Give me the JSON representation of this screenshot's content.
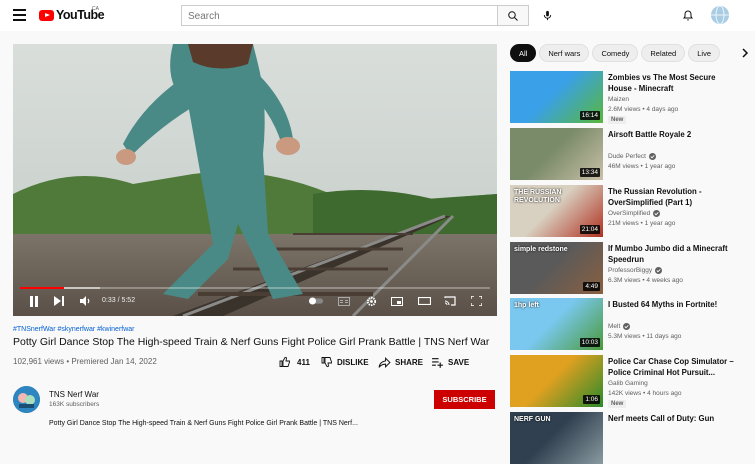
{
  "header": {
    "logo_text": "YouTube",
    "country_code": "CA",
    "search_placeholder": "Search"
  },
  "player": {
    "time_display": "0:33 / 5:52",
    "played_fraction": 0.094,
    "buffered_fraction": 0.17
  },
  "video": {
    "hashtags": "#TNSnerfWar #skynerfwar #kwinerfwar",
    "title": "Potty Girl Dance Stop The High-speed Train & Nerf Guns Fight Police Girl Prank Battle | TNS Nerf War",
    "meta": "102,961 views • Premiered Jan 14, 2022",
    "likes": "411",
    "dislike_label": "DISLIKE",
    "share_label": "SHARE",
    "save_label": "SAVE",
    "description_preview": "Potty Girl Dance Stop The High-speed Train & Nerf Guns Fight Police Girl Prank Battle | TNS Nerf..."
  },
  "channel": {
    "name": "TNS Nerf War",
    "subscribers": "163K subscribers",
    "subscribe_label": "SUBSCRIBE"
  },
  "chips": [
    "All",
    "Nerf wars",
    "Comedy",
    "Related",
    "Live"
  ],
  "recommendations": [
    {
      "title": "Zombies vs The Most Secure House - Minecraft",
      "channel": "Maizen",
      "verified": false,
      "stats": "2.6M views • 4 days ago",
      "badge": "New",
      "duration": "16:14",
      "thumb_colors": [
        "#3aa0e8",
        "#58b83a"
      ],
      "thumb_text": ""
    },
    {
      "title": "Airsoft Battle Royale 2",
      "channel": "Dude Perfect",
      "verified": true,
      "stats": "46M views • 1 year ago",
      "badge": "",
      "duration": "13:34",
      "thumb_colors": [
        "#7a8b6a",
        "#c9c0a8"
      ],
      "thumb_text": ""
    },
    {
      "title": "The Russian Revolution - OverSimplified (Part 1)",
      "channel": "OverSimplified",
      "verified": true,
      "stats": "21M views • 1 year ago",
      "badge": "",
      "duration": "21:04",
      "thumb_colors": [
        "#d8d0c0",
        "#b03020"
      ],
      "thumb_text": "THE RUSSIAN REVOLUTION"
    },
    {
      "title": "If Mumbo Jumbo did a Minecraft Speedrun",
      "channel": "ProfessorBiggy",
      "verified": true,
      "stats": "6.3M views • 4 weeks ago",
      "badge": "",
      "duration": "4:49",
      "thumb_colors": [
        "#5a5a5a",
        "#8a6040"
      ],
      "thumb_text": "simple redstone"
    },
    {
      "title": "I Busted 64 Myths in Fortnite!",
      "channel": "Melt",
      "verified": true,
      "stats": "5.3M views • 11 days ago",
      "badge": "",
      "duration": "10:03",
      "thumb_colors": [
        "#7ac8f0",
        "#4a9a3a"
      ],
      "thumb_text": "1hp left"
    },
    {
      "title": "Police Car Chase Cop Simulator – Police Criminal Hot Pursuit...",
      "channel": "Galib Gaming",
      "verified": false,
      "stats": "142K views • 4 hours ago",
      "badge": "New",
      "duration": "1:06",
      "thumb_colors": [
        "#e0a020",
        "#2a8a2a"
      ],
      "thumb_text": ""
    },
    {
      "title": "Nerf meets Call of Duty: Gun",
      "channel": "",
      "verified": false,
      "stats": "",
      "badge": "",
      "duration": "",
      "thumb_colors": [
        "#304050",
        "#8a9aa0"
      ],
      "thumb_text": "NERF GUN"
    }
  ]
}
